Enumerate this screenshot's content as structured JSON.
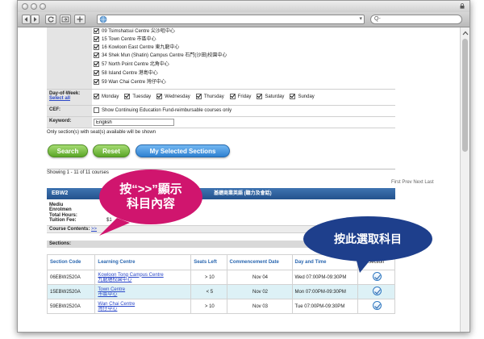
{
  "browser": {
    "search_placeholder": "Q-"
  },
  "form": {
    "centres": [
      "09 Tsimshatsui Centre 尖沙咀中心",
      "15 Town Centre 市區中心",
      "16 Kowloon East Centre 東九龍中心",
      "34 Shek Mun (Shatin) Campus Centre 石門(沙田)校園中心",
      "57 North Point Centre 北角中心",
      "58 Island Centre 港島中心",
      "59 Wan Chai Centre 灣仔中心"
    ],
    "day_of_week_label": "Day-of-Week:",
    "select_all": "Select all",
    "days": [
      "Monday",
      "Tuesday",
      "Wednesday",
      "Thursday",
      "Friday",
      "Saturday",
      "Sunday"
    ],
    "cef_label": "CEF:",
    "cef_option": "Show Continuing Education Fund-reimbursable courses only",
    "keyword_label": "Keyword:",
    "keyword_value": "English",
    "seat_note": "Only section(s) with seat(s) available will be shown"
  },
  "buttons": {
    "search": "Search",
    "reset": "Reset",
    "my_selected": "My Selected Sections"
  },
  "results": {
    "showing": "Showing 1 - 11 of 11 courses",
    "pager": "First Prev Next Last",
    "course_code": "EBW2",
    "course_title_zh": "基礎商業英語 (聽力及會話)",
    "detail_labels": [
      "Mediu",
      "Enrolmen",
      "Total Hours:",
      "Tuition Fee:"
    ],
    "tuition_partial": "$1",
    "course_contents_label": "Course Contents:",
    "course_contents_link": ">>",
    "sections_label": "Sections:"
  },
  "table": {
    "headers": [
      "Section Code",
      "Learning Centre",
      "Seats Left",
      "Commencement Date",
      "Day and Time",
      "Section"
    ],
    "rows": [
      {
        "code": "06EBW2520A",
        "centre_en": "Kowloon Tong Campus Centre",
        "centre_zh": "九龍塘校園中心",
        "seats": "> 10",
        "date": "Nov 04",
        "time": "Wed 07:00PM-09:30PM"
      },
      {
        "code": "15EBW2520A",
        "centre_en": "Town Centre",
        "centre_zh": "市區中心",
        "seats": "< 5",
        "date": "Nov 02",
        "time": "Mon 07:00PM-09:30PM"
      },
      {
        "code": "59EBW2520A",
        "centre_en": "Wan Chai Centre",
        "centre_zh": "灣仔中心",
        "seats": "> 10",
        "date": "Nov 03",
        "time": "Tue 07:00PM-09:30PM"
      }
    ]
  },
  "callouts": {
    "pink_line1": "按“>>”顯示",
    "pink_line2": "科目內容",
    "navy": "按此選取科目"
  },
  "colors": {
    "pink": "#d0156e",
    "navy": "#1e3f8c",
    "header_blue": "#2e62a3",
    "green_button": "#6db33a",
    "blue_button": "#3b8de0"
  }
}
